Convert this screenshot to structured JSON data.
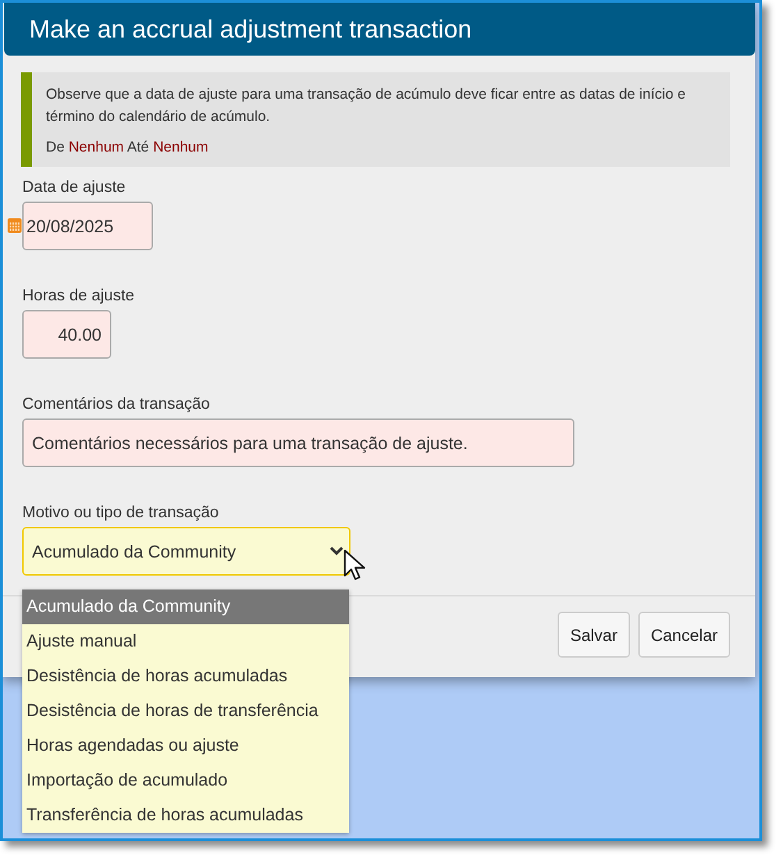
{
  "dialog": {
    "title": "Make an accrual adjustment transaction"
  },
  "notice": {
    "text": "Observe que a data de ajuste para uma transação de acúmulo deve ficar entre as datas de início e término do calendário de acúmulo.",
    "from_label": "De",
    "from": "Nenhum",
    "to_label": "Até",
    "to": "Nenhum"
  },
  "fields": [
    {
      "kind": "date",
      "label": "Data de ajuste",
      "value": "20/08/2025"
    },
    {
      "kind": "number",
      "label": "Horas de ajuste",
      "value": "40.00"
    },
    {
      "kind": "text",
      "label": "Comentários da transação",
      "value": "Comentários necessários para uma transação de ajuste."
    },
    {
      "kind": "select",
      "label": "Motivo ou tipo de transação",
      "value": "Acumulado da Community",
      "expanded": true,
      "options": [
        {
          "label": "Acumulado da Community",
          "selected": true
        },
        {
          "label": "Ajuste manual",
          "selected": false
        },
        {
          "label": "Desistência de horas acumuladas",
          "selected": false
        },
        {
          "label": "Desistência de horas de transferência",
          "selected": false
        },
        {
          "label": "Horas agendadas ou ajuste",
          "selected": false
        },
        {
          "label": "Importação de acumulado",
          "selected": false
        },
        {
          "label": "Transferência de horas acumuladas",
          "selected": false
        }
      ]
    }
  ],
  "buttons": [
    "Salvar",
    "Cancelar"
  ]
}
